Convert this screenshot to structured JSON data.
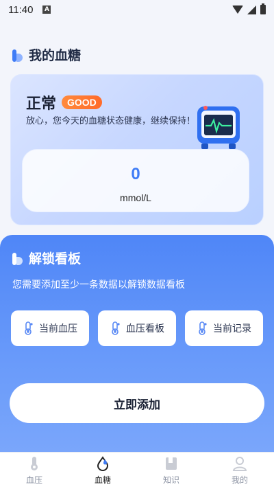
{
  "status_bar": {
    "time": "11:40",
    "notification_letter": "A"
  },
  "my_sugar": {
    "title": "我的血糖",
    "status_text": "正常",
    "badge": "GOOD",
    "description": "放心，您今天的血糖状态健康，继续保持！",
    "value": "0",
    "unit": "mmol/L"
  },
  "unlock": {
    "title": "解锁看板",
    "description": "您需要添加至少一条数据以解锁数据看板",
    "buttons": [
      {
        "label": "当前血压"
      },
      {
        "label": "血压看板"
      },
      {
        "label": "当前记录"
      }
    ],
    "add_button": "立即添加"
  },
  "bottom_nav": [
    {
      "label": "血压",
      "icon": "thermometer-icon"
    },
    {
      "label": "血糖",
      "icon": "blood-drop-icon",
      "active": true
    },
    {
      "label": "知识",
      "icon": "book-icon"
    },
    {
      "label": "我的",
      "icon": "person-icon"
    }
  ],
  "colors": {
    "accent": "#3f7cf6",
    "panel_gradient_top": "#4f86f7",
    "badge": "#ff7a33"
  }
}
